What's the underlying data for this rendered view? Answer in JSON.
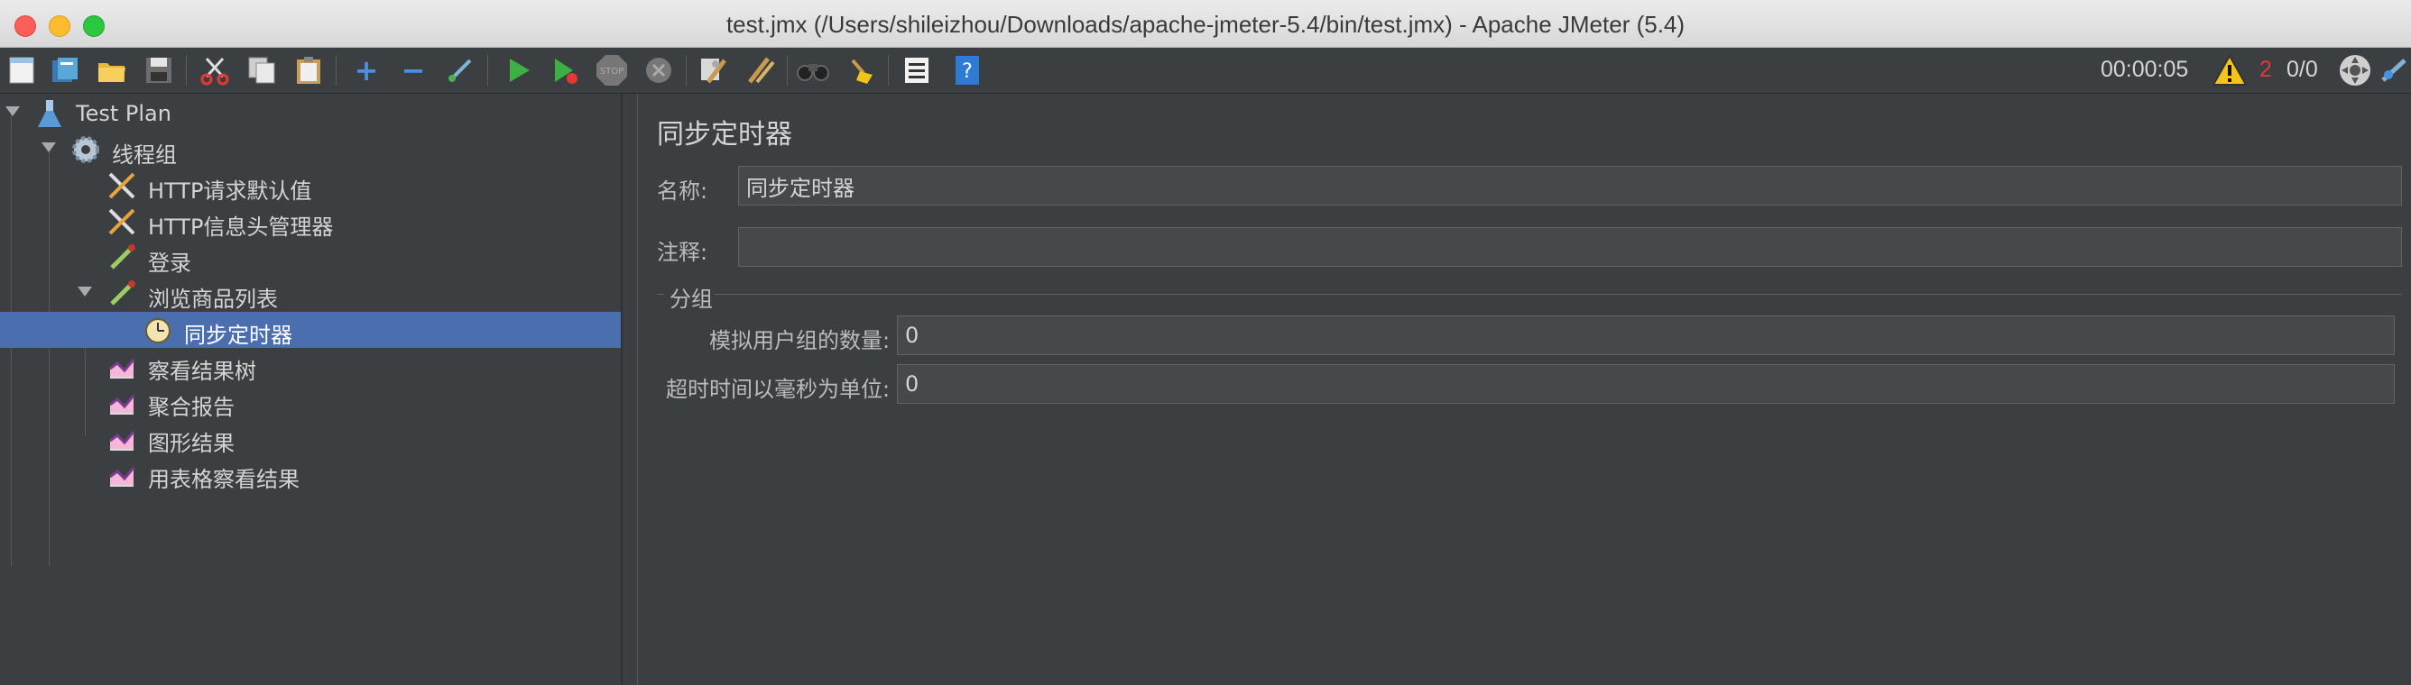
{
  "window": {
    "title": "test.jmx (/Users/shileizhou/Downloads/apache-jmeter-5.4/bin/test.jmx) - Apache JMeter (5.4)"
  },
  "toolbar": {
    "buttons": [
      "new-icon",
      "templates-icon",
      "open-icon",
      "save-icon",
      "cut-icon",
      "copy-icon",
      "paste-icon",
      "expand-icon",
      "collapse-icon",
      "toggle-icon",
      "start-icon",
      "start-no-pause-icon",
      "stop-icon",
      "shutdown-icon",
      "clear-icon",
      "clear-all-icon",
      "search-icon",
      "reset-search-icon",
      "function-helper-icon",
      "help-icon"
    ],
    "stop_label": "STOP",
    "elapsed_time": "00:00:05",
    "warning_count": "2",
    "threads": "0/0"
  },
  "tree": {
    "nodes": [
      {
        "label": "Test Plan",
        "icon": "flask-icon"
      },
      {
        "label": "线程组",
        "icon": "gear-icon"
      },
      {
        "label": "HTTP请求默认值",
        "icon": "wrench-icon"
      },
      {
        "label": "HTTP信息头管理器",
        "icon": "wrench-icon"
      },
      {
        "label": "登录",
        "icon": "pipette-icon"
      },
      {
        "label": "浏览商品列表",
        "icon": "pipette-icon"
      },
      {
        "label": "同步定时器",
        "icon": "clock-icon",
        "selected": true
      },
      {
        "label": "察看结果树",
        "icon": "graph-icon"
      },
      {
        "label": "聚合报告",
        "icon": "graph-icon"
      },
      {
        "label": "图形结果",
        "icon": "graph-icon"
      },
      {
        "label": "用表格察看结果",
        "icon": "graph-icon"
      }
    ]
  },
  "panel": {
    "title": "同步定时器",
    "name_label": "名称:",
    "name_value": "同步定时器",
    "comment_label": "注释:",
    "comment_value": "",
    "group_title": "分组",
    "users_label": "模拟用户组的数量:",
    "users_value": "0",
    "timeout_label": "超时时间以毫秒为单位:",
    "timeout_value": "0"
  },
  "colors": {
    "background": "#3c3f41",
    "selection": "#4b6eaf",
    "field": "#45494a",
    "warning_count": "#e53935"
  }
}
